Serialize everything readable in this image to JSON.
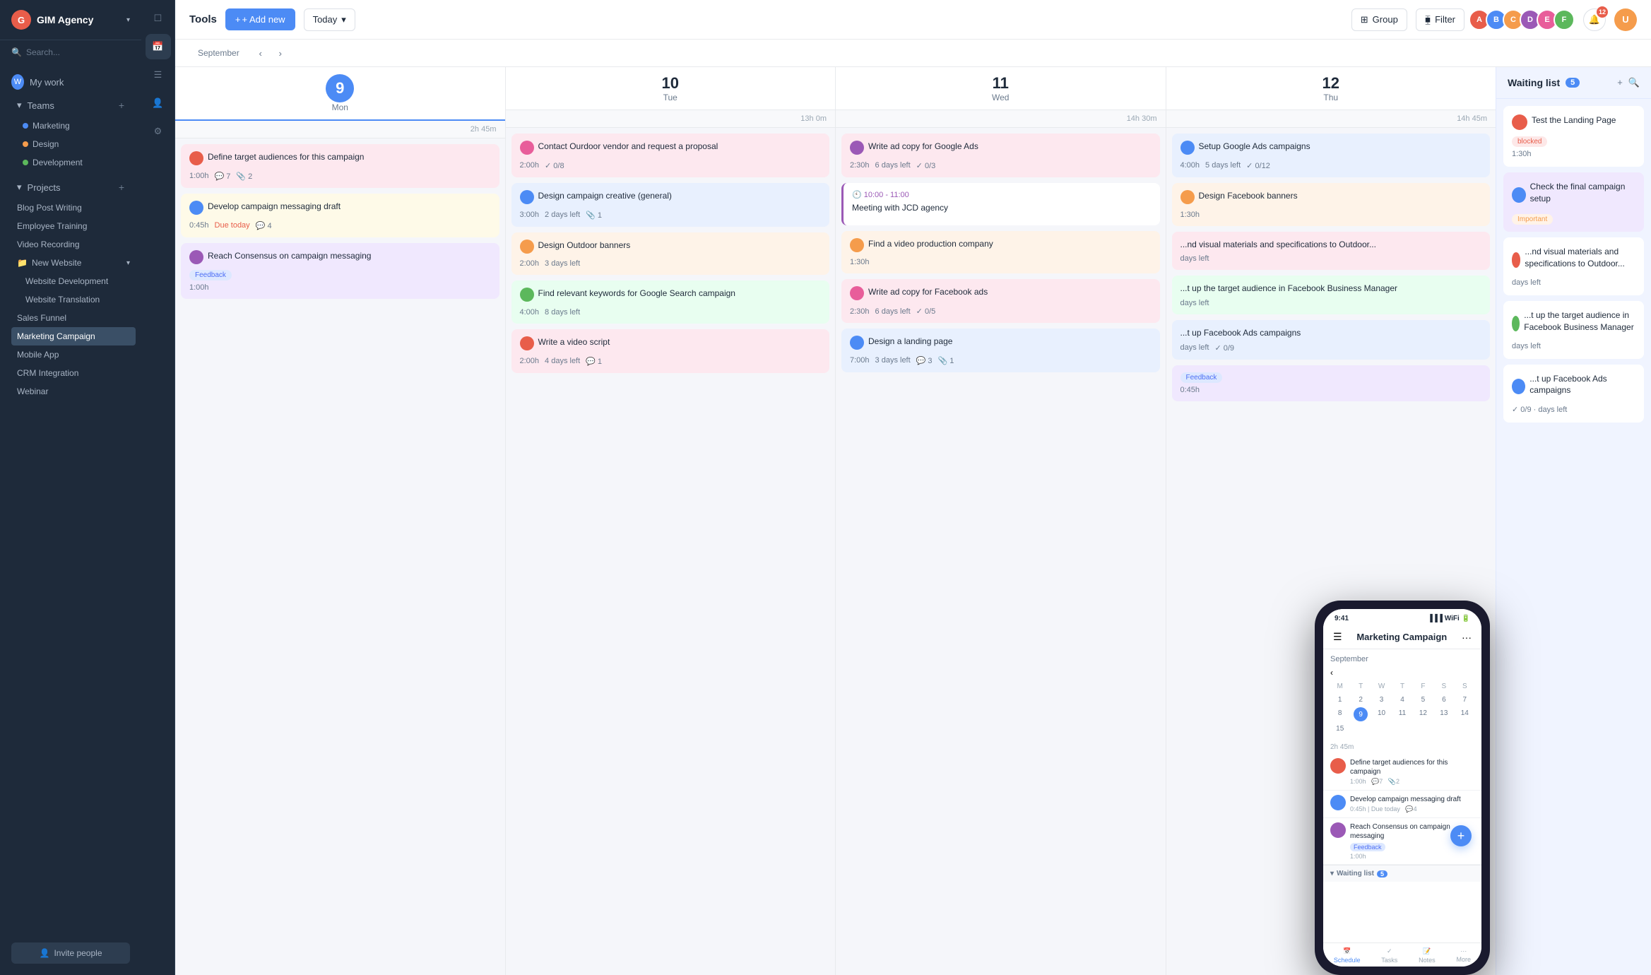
{
  "app": {
    "logo_text": "G",
    "company": "GIM Agency",
    "tools_label": "Tools"
  },
  "sidebar": {
    "my_work_label": "My work",
    "teams_label": "Teams",
    "teams_items": [
      "Marketing",
      "Design",
      "Development"
    ],
    "projects_label": "Projects",
    "projects_items": [
      {
        "label": "Blog Post Writing",
        "active": false
      },
      {
        "label": "Employee Training",
        "active": false
      },
      {
        "label": "Video Recording",
        "active": false
      },
      {
        "label": "New Website",
        "active": false,
        "has_sub": true
      },
      {
        "label": "Sales Funnel",
        "active": false
      },
      {
        "label": "Marketing Campaign",
        "active": true
      },
      {
        "label": "Mobile App",
        "active": false
      },
      {
        "label": "CRM Integration",
        "active": false
      },
      {
        "label": "Webinar",
        "active": false
      }
    ],
    "sub_items": [
      "Website Development",
      "Website Translation"
    ],
    "invite_label": "Invite people"
  },
  "topbar": {
    "add_new_label": "+ Add new",
    "today_label": "Today",
    "group_label": "Group",
    "filter_label": "Filter"
  },
  "calendar": {
    "month": "September",
    "days": [
      {
        "num": "9",
        "name": "Mon",
        "total": "2h 45m",
        "is_today": true
      },
      {
        "num": "10",
        "name": "Tue",
        "total": "13h 0m",
        "is_today": false
      },
      {
        "num": "11",
        "name": "Wed",
        "total": "14h 30m",
        "is_today": false
      },
      {
        "num": "12",
        "name": "Thu",
        "total": "14h 45m",
        "is_today": false
      }
    ],
    "mon_tasks": [
      {
        "title": "Define target audiences for this campaign",
        "time": "1:00h",
        "color": "pink",
        "comments": "7",
        "attachments": "2",
        "avatar_color": "#e85d4a"
      },
      {
        "title": "Develop campaign messaging draft",
        "time": "0:45h",
        "due": "Due today",
        "color": "yellow",
        "comments": "4",
        "avatar_color": "#4c8bf5"
      },
      {
        "title": "Reach Consensus on campaign messaging",
        "time": "1:00h",
        "badge": "Feedback",
        "color": "purple",
        "avatar_color": "#9b59b6"
      }
    ],
    "tue_tasks": [
      {
        "title": "Contact Ourdoor vendor and request a proposal",
        "time": "2:00h",
        "checks": "0/8",
        "color": "pink",
        "avatar_color": "#e85d9a"
      },
      {
        "title": "Design campaign creative (general)",
        "time": "3:00h",
        "due": "2 days left",
        "attachments": "1",
        "color": "blue",
        "avatar_color": "#4c8bf5"
      },
      {
        "title": "Design Outdoor banners",
        "time": "2:00h",
        "due": "3 days left",
        "color": "orange",
        "avatar_color": "#f59c4c"
      },
      {
        "title": "Find relevant keywords for Google Search campaign",
        "time": "4:00h",
        "due": "8 days left",
        "color": "green",
        "avatar_color": "#5cb85c"
      },
      {
        "title": "Write a video script",
        "time": "2:00h",
        "due": "4 days left",
        "comments": "1",
        "color": "pink",
        "avatar_color": "#e85d4a"
      }
    ],
    "wed_tasks": [
      {
        "title": "Write ad copy for Google Ads",
        "time": "2:30h",
        "due": "6 days left",
        "checks": "0/3",
        "color": "pink",
        "avatar_color": "#9b59b6"
      },
      {
        "title": "10:00 - 11:00",
        "event_title": "Meeting with JCD agency",
        "is_event": true,
        "color": "purple"
      },
      {
        "title": "Find a video production company",
        "time": "1:30h",
        "color": "orange",
        "avatar_color": "#f59c4c"
      },
      {
        "title": "Write ad copy for Facebook ads",
        "time": "2:30h",
        "due": "6 days left",
        "checks": "0/5",
        "color": "pink",
        "avatar_color": "#e85d9a"
      },
      {
        "title": "Design a landing page",
        "time": "7:00h",
        "due": "3 days left",
        "comments": "3",
        "attachments": "1",
        "color": "blue",
        "avatar_color": "#4c8bf5"
      }
    ],
    "thu_tasks": [
      {
        "title": "Setup Google Ads campaigns",
        "time": "4:00h",
        "due": "5 days left",
        "checks": "0/12",
        "color": "blue",
        "avatar_color": "#4c8bf5"
      },
      {
        "title": "Design Facebook banners",
        "time": "1:30h",
        "color": "orange",
        "avatar_color": "#f59c4c"
      },
      {
        "title": "...nd visual materials and specifications to Outdoor...",
        "time": "",
        "due": "days left",
        "color": "pink",
        "avatar_color": "#e85d4a"
      },
      {
        "title": "...t up the target audience in Facebook Business Manager",
        "time": "",
        "due": "days left",
        "color": "green",
        "avatar_color": "#5cb85c"
      },
      {
        "title": "...t up Facebook Ads campaigns",
        "time": "",
        "due": "days left",
        "checks": "0/9",
        "color": "blue",
        "avatar_color": "#4c8bf5"
      },
      {
        "title": "Feedback",
        "time": "0:45h",
        "badge": "Feedback",
        "color": "purple",
        "avatar_color": "#9b59b6"
      }
    ]
  },
  "waiting_list": {
    "title": "Waiting list",
    "count": "5",
    "cards": [
      {
        "title": "Test the Landing Page",
        "badge": "blocked",
        "time": "1:30h",
        "avatar_color": "#e85d4a"
      },
      {
        "title": "Check the final campaign setup",
        "badge": "Important",
        "avatar_color": "#4c8bf5"
      },
      {
        "title": "...nd visual materials and specifications to Outdoor...",
        "due": "days left",
        "avatar_color": "#e85d4a"
      },
      {
        "title": "...t up the target audience in Facebook Business Manager",
        "due": "days left",
        "avatar_color": "#5cb85c"
      },
      {
        "title": "...t up Facebook Ads campaigns",
        "checks": "0/9",
        "due": "days left",
        "avatar_color": "#4c8bf5"
      }
    ]
  },
  "phone": {
    "time": "9:41",
    "title": "Marketing Campaign",
    "month_label": "September",
    "cal_headers": [
      "M",
      "T",
      "W",
      "T",
      "F",
      "S",
      "S"
    ],
    "cal_days": [
      "",
      "",
      "",
      "",
      "",
      "",
      "",
      "1",
      "2",
      "3",
      "4",
      "5",
      "6",
      "7",
      "8",
      "9",
      "10",
      "11",
      "12",
      "13",
      "14",
      "15"
    ],
    "today_date": "9",
    "time_label": "2h 45m",
    "tasks": [
      {
        "title": "Define target audiences for this campaign",
        "meta": "1:00h",
        "comments": "7",
        "checks": "2",
        "avatar_color": "#e85d4a"
      },
      {
        "title": "Develop campaign messaging draft",
        "meta": "0:45h | Due today",
        "comments": "4",
        "avatar_color": "#4c8bf5"
      },
      {
        "title": "Reach Consensus on campaign messaging",
        "meta": "1:00h",
        "badge": "Feedback",
        "badge_color": "#dde8ff",
        "badge_text_color": "#4c6ef5",
        "avatar_color": "#9b59b6"
      }
    ],
    "waiting_label": "Waiting list",
    "waiting_count": "5",
    "footer_items": [
      "Schedule",
      "Tasks",
      "Notes",
      "More"
    ],
    "footer_icons": [
      "📅",
      "✓",
      "📝",
      "..."
    ]
  }
}
